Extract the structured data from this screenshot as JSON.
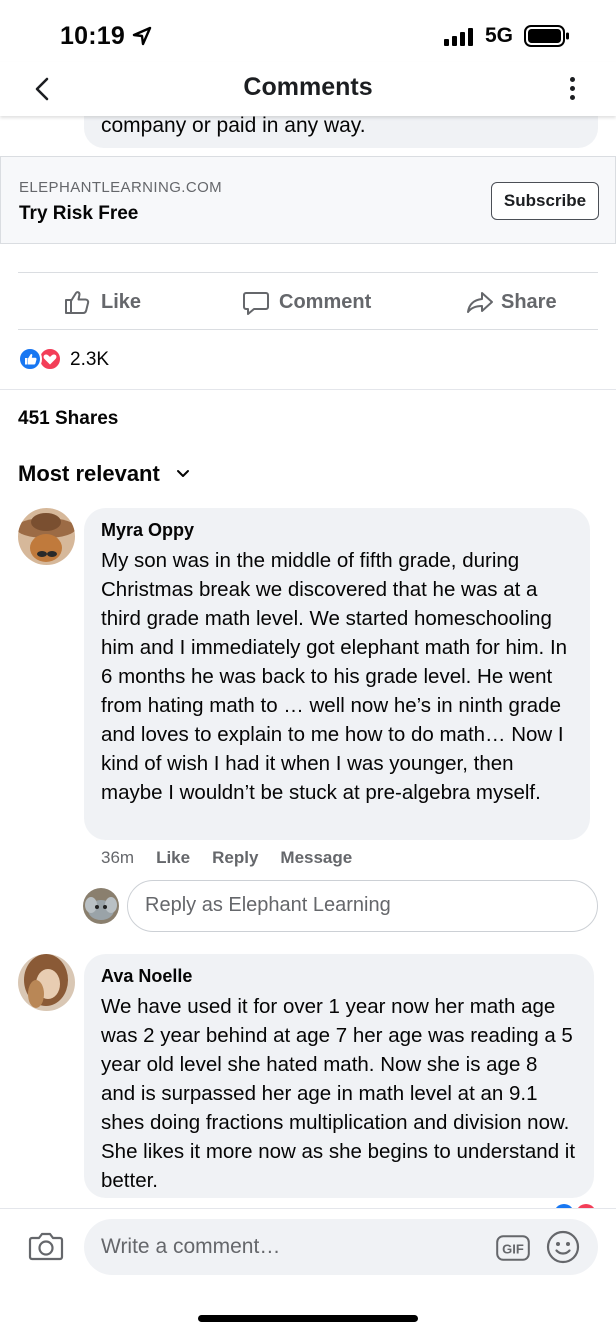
{
  "status_bar": {
    "time": "10:19",
    "network": "5G"
  },
  "nav": {
    "title": "Comments"
  },
  "previous_comment": {
    "text_tail": "company or paid in any way."
  },
  "ad": {
    "domain": "ELEPHANTLEARNING.COM",
    "title": "Try Risk Free",
    "cta": "Subscribe"
  },
  "actions": {
    "like": "Like",
    "comment": "Comment",
    "share": "Share"
  },
  "reactions": {
    "count": "2.3K"
  },
  "shares": "451 Shares",
  "sort": {
    "label": "Most relevant"
  },
  "comments": [
    {
      "author": "Myra Oppy",
      "text": "My son was in the middle of fifth grade, during Christmas break we discovered that he was at a third grade math level. We started homeschooling him and I immediately got elephant math for him. In 6 months he was back to his grade level. He went from hating math to … well now he’s in ninth grade and loves to explain to me how to do math… Now I kind of wish I had it when I was younger, then maybe I wouldn’t be stuck at pre-algebra myself.",
      "time": "36m",
      "like": "Like",
      "reply": "Reply",
      "message": "Message"
    },
    {
      "author": "Ava Noelle",
      "text": "We have used it for over 1 year now her math age was 2 year behind at age 7 her age was reading a 5 year old level she hated math. Now she is age 8 and is surpassed her age in math level at an 9.1 shes doing fractions multiplication and division now. She likes it more now as she begins to understand it better."
    }
  ],
  "reply_box": {
    "placeholder": "Reply as Elephant Learning"
  },
  "composer": {
    "placeholder": "Write a comment…"
  },
  "colors": {
    "fb_blue": "#1877f2",
    "love_red": "#f33e58",
    "bubble_gray": "#f0f2f5",
    "secondary_text": "#65676b"
  }
}
